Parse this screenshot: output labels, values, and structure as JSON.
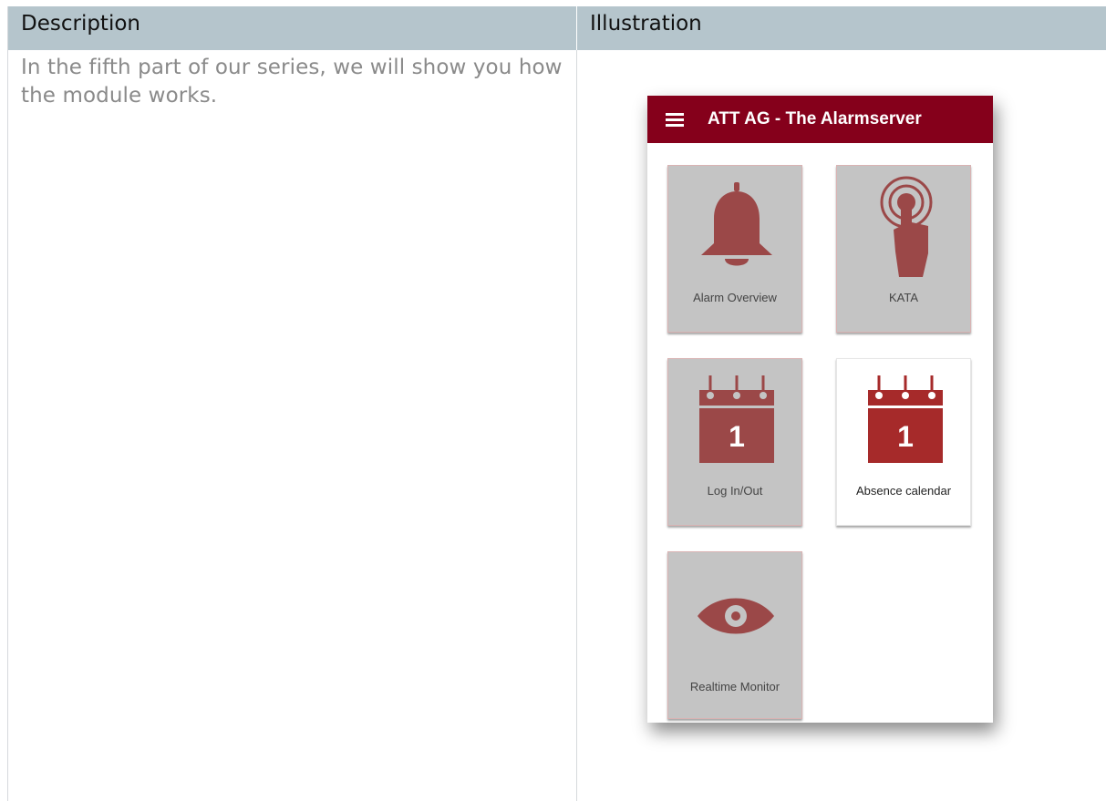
{
  "table": {
    "headers": {
      "description": "Description",
      "illustration": "Illustration"
    },
    "description_text": "In the fifth part of our series, we will show you how the module works."
  },
  "app": {
    "title": "ATT AG - The Alarmserver",
    "colors": {
      "app_bar": "#85001b",
      "icon": "#9b4848",
      "icon_active": "#a62a2a",
      "tile_bg": "#c4c4c4"
    },
    "tiles": [
      {
        "label": "Alarm Overview",
        "icon": "bell-icon"
      },
      {
        "label": "KATA",
        "icon": "touch-icon"
      },
      {
        "label": "Log In/Out",
        "icon": "calendar-icon",
        "day": "1"
      },
      {
        "label": "Absence calendar",
        "icon": "calendar-icon",
        "day": "1"
      },
      {
        "label": "Realtime Monitor",
        "icon": "eye-icon"
      }
    ]
  }
}
